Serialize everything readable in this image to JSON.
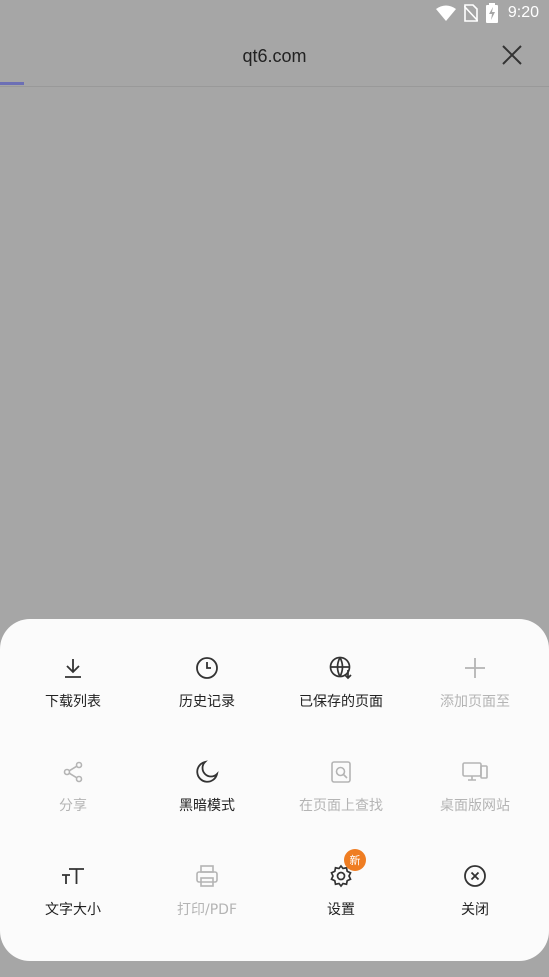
{
  "status_bar": {
    "time": "9:20"
  },
  "header": {
    "url": "qt6.com"
  },
  "menu": {
    "items": [
      {
        "label": "下载列表",
        "icon": "download-icon",
        "enabled": true
      },
      {
        "label": "历史记录",
        "icon": "clock-icon",
        "enabled": true
      },
      {
        "label": "已保存的页面",
        "icon": "saved-page-icon",
        "enabled": true
      },
      {
        "label": "添加页面至",
        "icon": "plus-icon",
        "enabled": false
      },
      {
        "label": "分享",
        "icon": "share-icon",
        "enabled": false
      },
      {
        "label": "黑暗模式",
        "icon": "moon-icon",
        "enabled": true
      },
      {
        "label": "在页面上查找",
        "icon": "find-in-page-icon",
        "enabled": false
      },
      {
        "label": "桌面版网站",
        "icon": "desktop-icon",
        "enabled": false
      },
      {
        "label": "文字大小",
        "icon": "text-size-icon",
        "enabled": true
      },
      {
        "label": "打印/PDF",
        "icon": "print-icon",
        "enabled": false
      },
      {
        "label": "设置",
        "icon": "gear-icon",
        "enabled": true,
        "badge": "新"
      },
      {
        "label": "关闭",
        "icon": "close-circle-icon",
        "enabled": true
      }
    ]
  },
  "colors": {
    "accent": "#6c6fb5",
    "badge": "#ef7d22",
    "scrim": "#a6a6a6"
  }
}
